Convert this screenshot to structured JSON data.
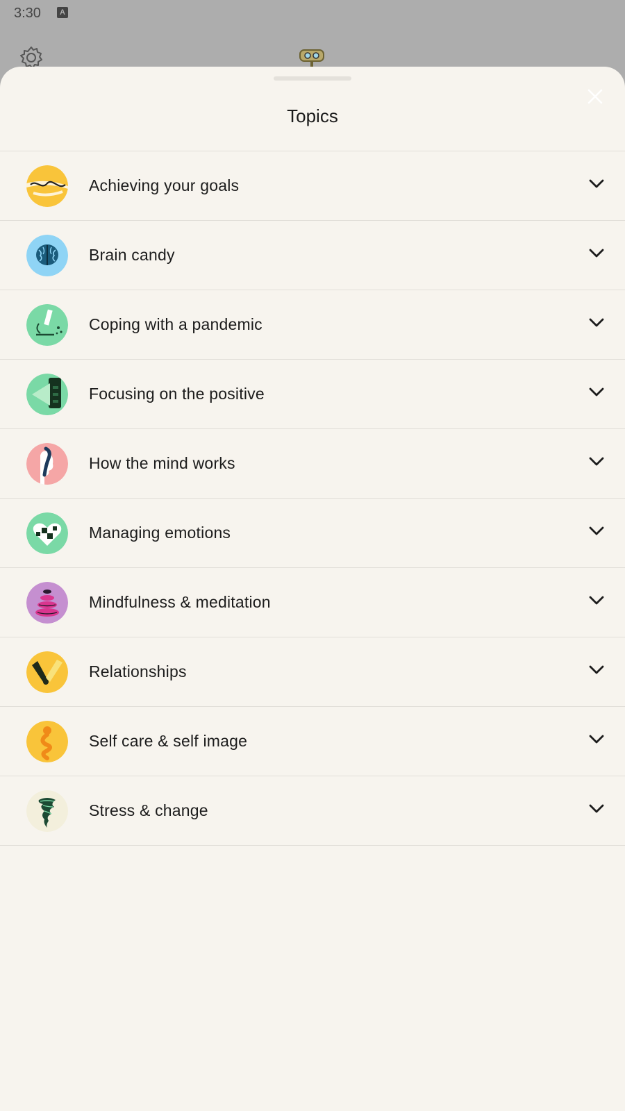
{
  "status_bar": {
    "time": "3:30",
    "notification_icon": "A"
  },
  "sheet": {
    "title": "Topics"
  },
  "topics": [
    {
      "label": "Achieving your goals",
      "icon": "goals-icon",
      "color": "#f9c43a"
    },
    {
      "label": "Brain candy",
      "icon": "brain-icon",
      "color": "#8fd4f5"
    },
    {
      "label": "Coping with a pandemic",
      "icon": "microscope-icon",
      "color": "#7ad9a6"
    },
    {
      "label": "Focusing on the positive",
      "icon": "phone-icon",
      "color": "#7ad9a6"
    },
    {
      "label": "How the mind works",
      "icon": "head-icon",
      "color": "#f5a6a6"
    },
    {
      "label": "Managing emotions",
      "icon": "heart-icon",
      "color": "#7ad9a6"
    },
    {
      "label": "Mindfulness & meditation",
      "icon": "stones-icon",
      "color": "#c58fd0"
    },
    {
      "label": "Relationships",
      "icon": "handshake-icon",
      "color": "#f9c43a"
    },
    {
      "label": "Self care & self image",
      "icon": "figure-icon",
      "color": "#f9c43a"
    },
    {
      "label": "Stress & change",
      "icon": "tornado-icon",
      "color": "#f7f4ee"
    }
  ]
}
